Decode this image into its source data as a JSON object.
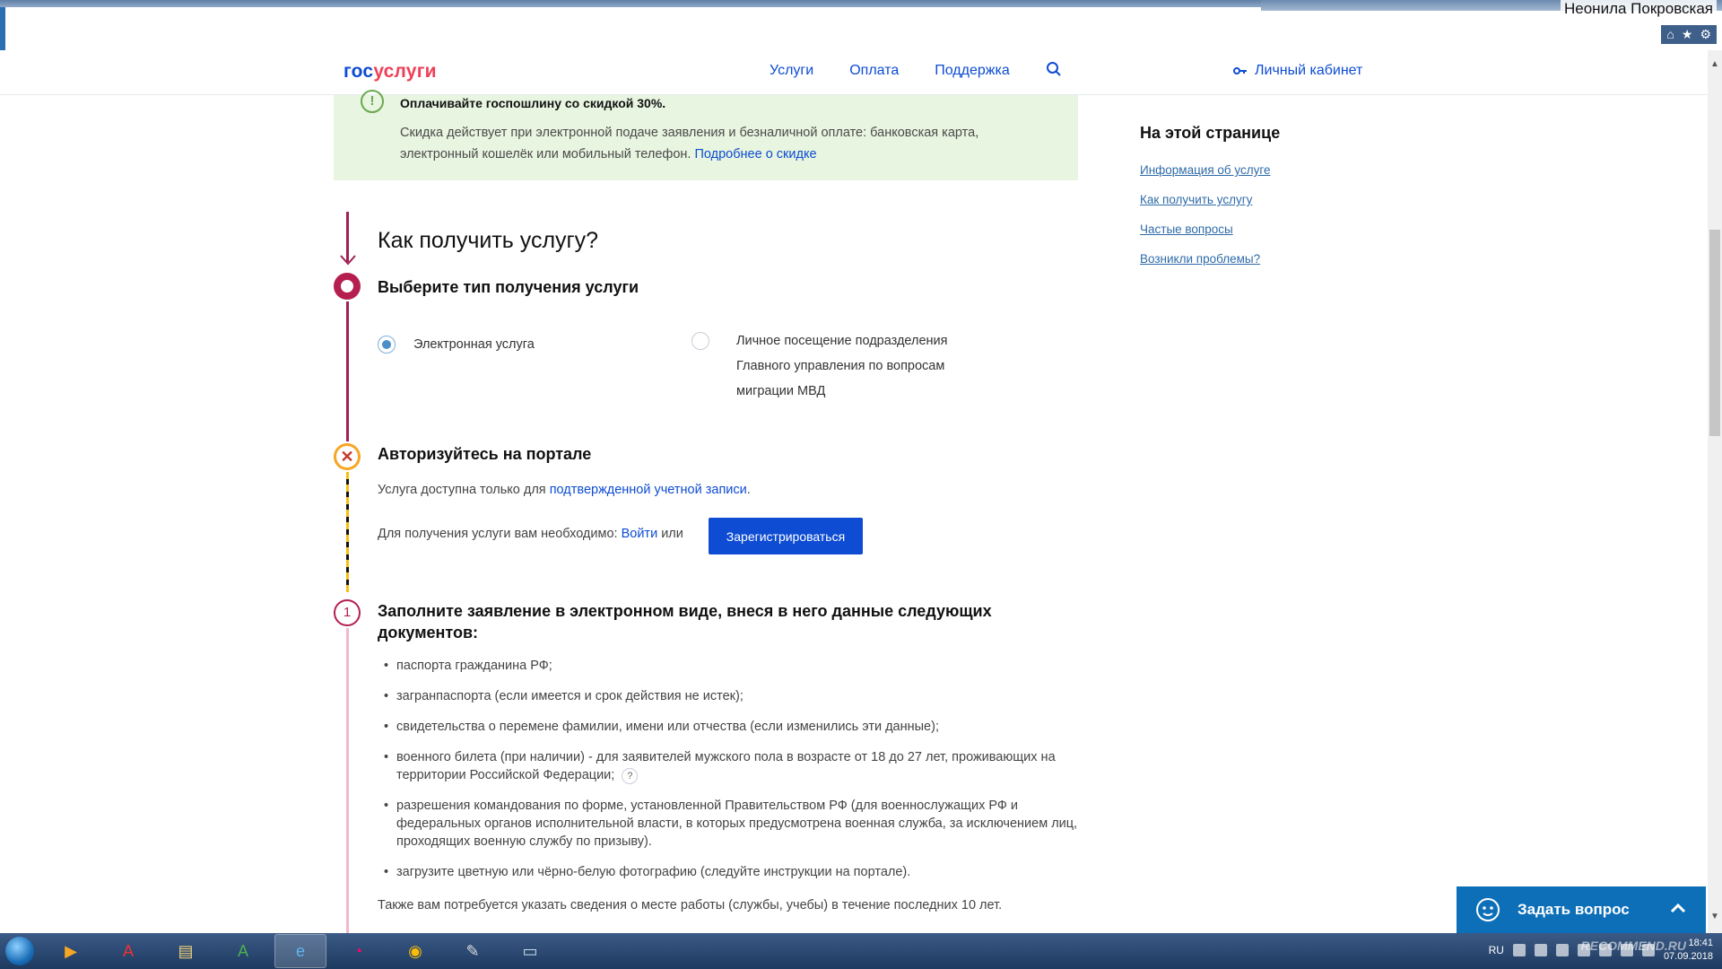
{
  "browser": {
    "user_name": "Неонила Покровская",
    "icons": [
      "home-icon",
      "star-icon",
      "gear-icon"
    ]
  },
  "header": {
    "logo_part1": "гос",
    "logo_part2": "услуги",
    "nav": [
      "Услуги",
      "Оплата",
      "Поддержка"
    ],
    "cabinet": "Личный кабинет"
  },
  "notice": {
    "title": "Оплачивайте госпошлину со скидкой 30%.",
    "text": "Скидка действует при электронной подаче заявления и безналичной оплате: банковская карта, электронный кошелёк или мобильный телефон.",
    "link": "Подробнее о скидке"
  },
  "sidebar": {
    "title": "На этой странице",
    "links": [
      "Информация об услуге",
      "Как получить услугу",
      "Частые вопросы",
      "Возникли проблемы?"
    ]
  },
  "main": {
    "how_title": "Как получить услугу?",
    "step1": {
      "title": "Выберите тип получения услуги",
      "option_electronic": "Электронная услуга",
      "option_personal": "Личное посещение подразделения Главного управления по вопросам миграции МВД",
      "selected": "electronic"
    },
    "step2": {
      "marker": "✕",
      "title": "Авторизуйтесь на портале",
      "text": "Услуга доступна только для",
      "link": "подтвержденной учетной записи",
      "text_end": ".",
      "need": "Для получения услуги вам необходимо:",
      "login": "Войти",
      "or": "или",
      "register": "Зарегистрироваться"
    },
    "step3": {
      "number": "1",
      "title": "Заполните заявление в электронном виде, внеся в него данные следующих документов:",
      "items": [
        "паспорта гражданина РФ;",
        "загранпаспорта (если имеется и срок действия не истек);",
        "свидетельства о перемене фамилии, имени или отчества (если изменились эти данные);",
        "военного билета (при наличии) - для заявителей мужского пола в возрасте от 18 до 27 лет, проживающих на территории Российской Федерации;",
        "разрешения командования по форме, установленной Правительством РФ (для военнослужащих РФ и федеральных органов исполнительной власти, в которых предусмотрена военная служба, за исключением лиц, проходящих военную службу по призыву).",
        "загрузите цветную или чёрно-белую фотографию (следуйте инструкции на портале)."
      ],
      "help_mark": "?",
      "also": "Также вам потребуется указать сведения о месте работы (службы, учебы) в течение последних 10 лет."
    }
  },
  "ask_widget": {
    "label": "Задать вопрос"
  },
  "taskbar": {
    "lang": "RU",
    "time": "18:41",
    "date": "07.09.2018",
    "watermark": "RECOMMEND.RU"
  },
  "colors": {
    "brand_blue": "#0d4cd3",
    "brand_red": "#ee3f58",
    "timeline_crimson": "#b41f4f",
    "notice_green": "#e8f5e0",
    "ask_blue": "#0d6fb8"
  }
}
